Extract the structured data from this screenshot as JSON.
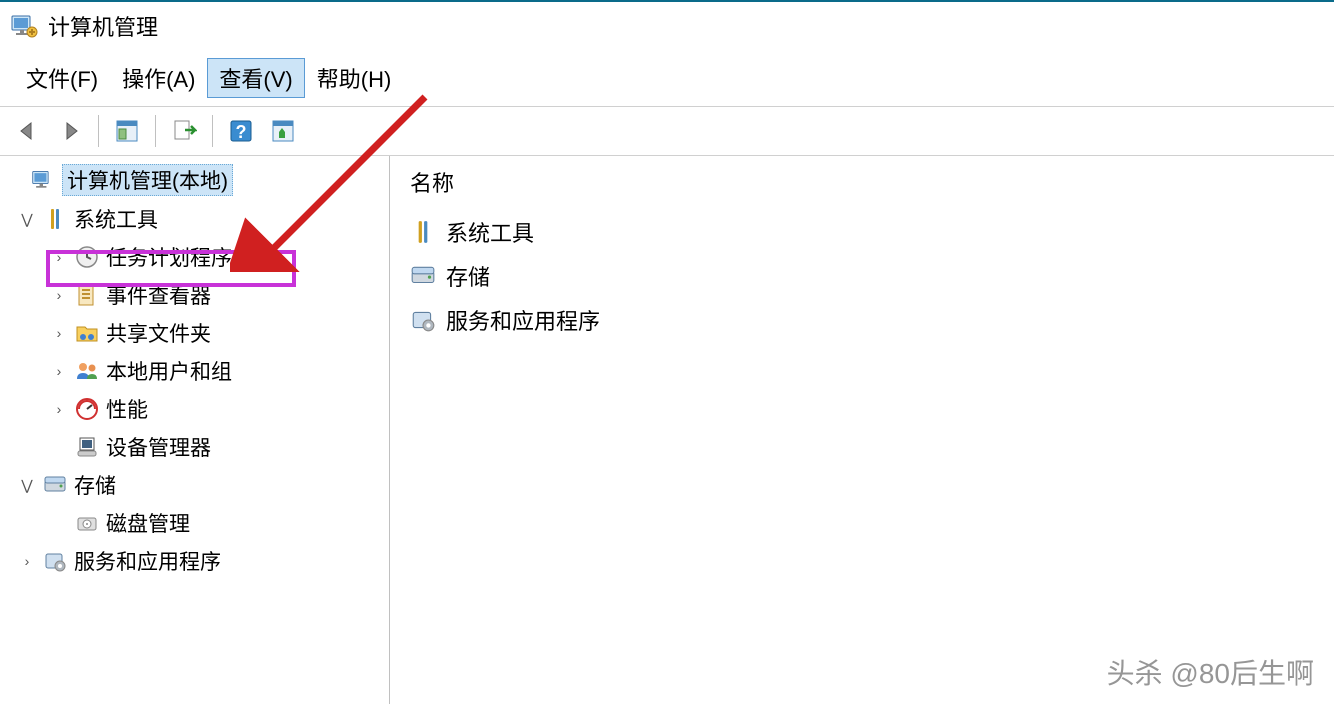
{
  "window": {
    "title": "计算机管理"
  },
  "menu": {
    "file": "文件(F)",
    "action": "操作(A)",
    "view": "查看(V)",
    "help": "帮助(H)"
  },
  "tree": {
    "root": "计算机管理(本地)",
    "system_tools": "系统工具",
    "task_scheduler": "任务计划程序",
    "event_viewer": "事件查看器",
    "shared_folders": "共享文件夹",
    "local_users": "本地用户和组",
    "performance": "性能",
    "device_manager": "设备管理器",
    "storage": "存储",
    "disk_management": "磁盘管理",
    "services_apps": "服务和应用程序"
  },
  "list": {
    "header": "名称",
    "items": {
      "system_tools": "系统工具",
      "storage": "存储",
      "services_apps": "服务和应用程序"
    }
  },
  "watermark": "头杀 @80后生啊"
}
